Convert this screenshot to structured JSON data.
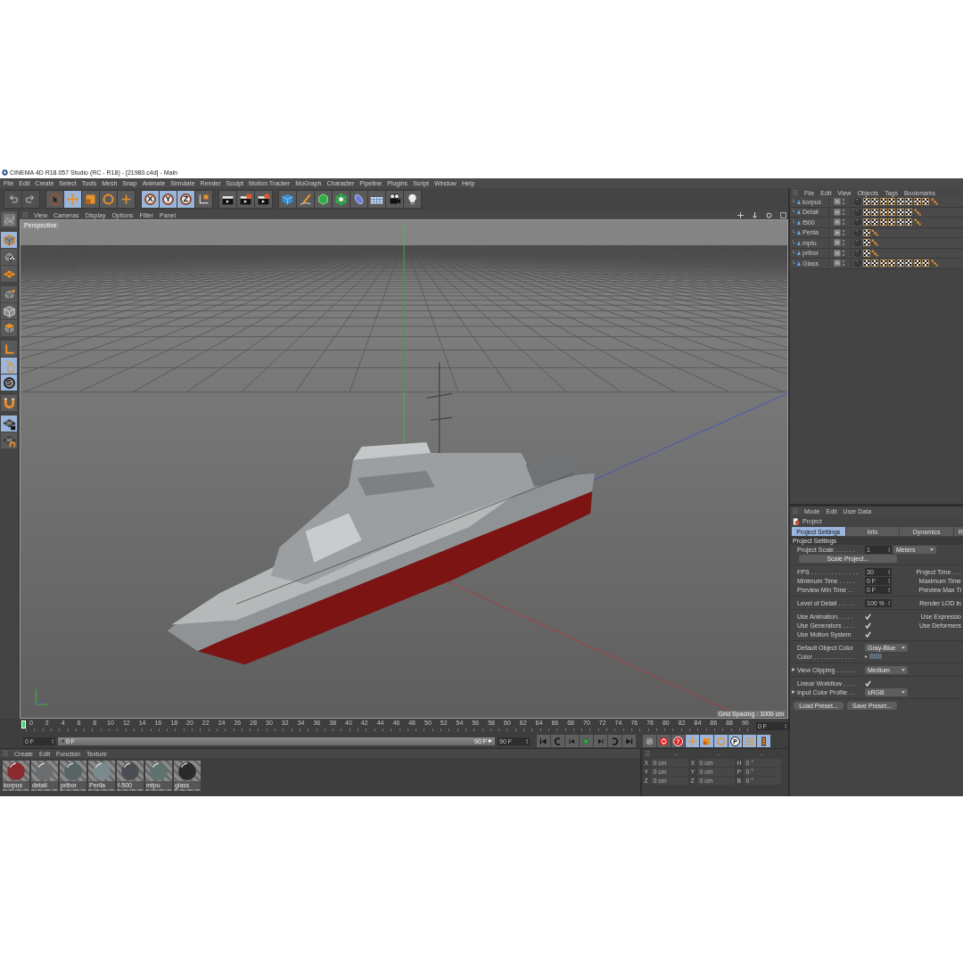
{
  "window": {
    "title": "CINEMA 4D R18.057 Studio (RC - R18) - [21980.c4d] - Main"
  },
  "menu_bar": [
    "File",
    "Edit",
    "Create",
    "Select",
    "Tools",
    "Mesh",
    "Snap",
    "Animate",
    "Simulate",
    "Render",
    "Sculpt",
    "Motion Tracker",
    "MoGraph",
    "Character",
    "Pipeline",
    "Plugins",
    "Script",
    "Window",
    "Help"
  ],
  "toolbar": [
    {
      "items": [
        {
          "kind": "undo",
          "selected": false
        },
        {
          "kind": "redo",
          "selected": false
        }
      ]
    },
    {
      "items": [
        {
          "kind": "select",
          "selected": false
        },
        {
          "kind": "move",
          "selected": true
        },
        {
          "kind": "scale",
          "selected": false
        },
        {
          "kind": "rotate",
          "selected": false
        },
        {
          "kind": "recent",
          "selected": false
        }
      ]
    },
    {
      "items": [
        {
          "kind": "axis",
          "label": "X",
          "selected": true
        },
        {
          "kind": "axis",
          "label": "Y",
          "selected": true
        },
        {
          "kind": "axis",
          "label": "Z",
          "selected": true
        },
        {
          "kind": "coordsys",
          "selected": false
        }
      ]
    },
    {
      "items": [
        {
          "kind": "render-view",
          "selected": false
        },
        {
          "kind": "render-picture",
          "selected": false
        },
        {
          "kind": "render-settings",
          "selected": false
        }
      ]
    },
    {
      "items": [
        {
          "kind": "cube",
          "selected": false
        },
        {
          "kind": "pen",
          "selected": false
        },
        {
          "kind": "subdiv",
          "selected": false
        },
        {
          "kind": "cloner",
          "selected": false
        },
        {
          "kind": "deformer",
          "selected": false
        },
        {
          "kind": "floor",
          "selected": false
        },
        {
          "kind": "camera",
          "selected": false
        },
        {
          "kind": "light",
          "selected": false
        }
      ]
    }
  ],
  "tool_strip": [
    {
      "items": [
        {
          "kind": "editable",
          "selected": false
        }
      ]
    },
    {
      "items": [
        {
          "kind": "model",
          "selected": true
        },
        {
          "kind": "texture",
          "selected": false
        },
        {
          "kind": "workplane",
          "selected": false
        }
      ]
    },
    {
      "items": [
        {
          "kind": "points",
          "selected": false
        },
        {
          "kind": "edges",
          "selected": false
        },
        {
          "kind": "polygons",
          "selected": false
        }
      ]
    },
    {
      "items": [
        {
          "kind": "axis-mode",
          "selected": false
        },
        {
          "kind": "tweak",
          "selected": true
        },
        {
          "kind": "solo",
          "label": "S",
          "selected": true
        }
      ]
    },
    {
      "items": [
        {
          "kind": "snap",
          "selected": false
        }
      ]
    },
    {
      "items": [
        {
          "kind": "wp-lock",
          "selected": true
        },
        {
          "kind": "planar",
          "selected": false
        }
      ]
    }
  ],
  "viewport": {
    "menu": [
      "View",
      "Cameras",
      "Display",
      "Options",
      "Filter",
      "Panel"
    ],
    "camera": "Perspective",
    "grid_spacing": "Grid Spacing : 1000 cm"
  },
  "timeline": {
    "ticks": [
      "0",
      "2",
      "4",
      "6",
      "8",
      "10",
      "12",
      "14",
      "16",
      "18",
      "20",
      "22",
      "24",
      "26",
      "28",
      "30",
      "32",
      "34",
      "36",
      "38",
      "40",
      "42",
      "44",
      "46",
      "48",
      "50",
      "52",
      "54",
      "56",
      "58",
      "60",
      "62",
      "64",
      "66",
      "68",
      "70",
      "72",
      "74",
      "76",
      "78",
      "80",
      "82",
      "84",
      "86",
      "88",
      "90"
    ],
    "current_frame": "0 F",
    "start_field": "0 F",
    "range": {
      "start": "0 F",
      "end": "90 F",
      "level": 1
    },
    "end_field": "90 F",
    "transport": [
      {
        "kind": "first",
        "selected": false
      },
      {
        "kind": "prev-key",
        "selected": false
      },
      {
        "kind": "prev-frame",
        "selected": false
      },
      {
        "kind": "play",
        "selected": false
      },
      {
        "kind": "next-frame",
        "selected": false
      },
      {
        "kind": "next-key",
        "selected": false
      },
      {
        "kind": "last",
        "selected": false
      }
    ],
    "keying": [
      {
        "kind": "key",
        "selected": false
      },
      {
        "kind": "record",
        "selected": false
      },
      {
        "kind": "autokey",
        "label": "?",
        "selected": false
      },
      {
        "kind": "move",
        "selected": true
      },
      {
        "kind": "scale",
        "selected": true
      },
      {
        "kind": "rotate",
        "selected": true
      },
      {
        "kind": "param",
        "label": "P",
        "selected": true
      },
      {
        "kind": "pointgrid",
        "selected": true
      },
      {
        "kind": "timeline",
        "selected": true
      }
    ]
  },
  "materials": {
    "menu": [
      "Create",
      "Edit",
      "Function",
      "Texture"
    ],
    "items": [
      {
        "name": "korpus",
        "color": "#8a2a2a"
      },
      {
        "name": "detali",
        "color": "#6a6e70"
      },
      {
        "name": "pribor",
        "color": "#566466"
      },
      {
        "name": "Perila",
        "color": "#7b8a8c"
      },
      {
        "name": "f-500",
        "color": "#4a4e52"
      },
      {
        "name": "mtpu",
        "color": "#5f7270"
      },
      {
        "name": "glass",
        "color": "#2a2a2a"
      }
    ]
  },
  "coordinates": {
    "headers": [
      "--",
      "--",
      "--"
    ],
    "rows": [
      {
        "axis": "X",
        "position": "0 cm",
        "size_axis": "X",
        "size": "0 cm",
        "rot_axis": "H",
        "rotation": "0 °"
      },
      {
        "axis": "Y",
        "position": "0 cm",
        "size_axis": "Y",
        "size": "0 cm",
        "rot_axis": "P",
        "rotation": "0 °"
      },
      {
        "axis": "Z",
        "position": "0 cm",
        "size_axis": "Z",
        "size": "0 cm",
        "rot_axis": "B",
        "rotation": "0 °"
      }
    ]
  },
  "object_manager": {
    "menu": [
      "File",
      "Edit",
      "View",
      "Objects",
      "Tags",
      "Bookmarks"
    ],
    "objects": [
      {
        "name": "korpus",
        "tags": [
          {
            "kind": "material"
          },
          {
            "kind": "texture"
          },
          {
            "kind": "texture"
          },
          {
            "kind": "texture"
          },
          {
            "kind": "texture"
          },
          {
            "kind": "texture"
          },
          {
            "kind": "texture"
          },
          {
            "kind": "texture"
          },
          {
            "kind": "texture"
          },
          {
            "kind": "selection"
          }
        ]
      },
      {
        "name": "Detali",
        "tags": [
          {
            "kind": "material"
          },
          {
            "kind": "texture"
          },
          {
            "kind": "texture"
          },
          {
            "kind": "texture"
          },
          {
            "kind": "texture"
          },
          {
            "kind": "texture"
          },
          {
            "kind": "texture"
          },
          {
            "kind": "selection"
          }
        ]
      },
      {
        "name": "f500",
        "tags": [
          {
            "kind": "material"
          },
          {
            "kind": "texture"
          },
          {
            "kind": "texture"
          },
          {
            "kind": "texture"
          },
          {
            "kind": "texture"
          },
          {
            "kind": "texture"
          },
          {
            "kind": "texture"
          },
          {
            "kind": "selection"
          }
        ]
      },
      {
        "name": "Perila",
        "tags": [
          {
            "kind": "material"
          },
          {
            "kind": "texture"
          },
          {
            "kind": "selection"
          }
        ]
      },
      {
        "name": "mptu",
        "tags": [
          {
            "kind": "material"
          },
          {
            "kind": "texture"
          },
          {
            "kind": "selection"
          }
        ]
      },
      {
        "name": "pribor",
        "tags": [
          {
            "kind": "material"
          },
          {
            "kind": "texture"
          },
          {
            "kind": "selection"
          }
        ]
      },
      {
        "name": "Glass",
        "tags": [
          {
            "kind": "material"
          },
          {
            "kind": "texture"
          },
          {
            "kind": "texture"
          },
          {
            "kind": "texture"
          },
          {
            "kind": "texture"
          },
          {
            "kind": "texture"
          },
          {
            "kind": "texture"
          },
          {
            "kind": "texture"
          },
          {
            "kind": "texture"
          },
          {
            "kind": "selection"
          }
        ]
      }
    ]
  },
  "attributes": {
    "menu": [
      "Mode",
      "Edit",
      "User Data"
    ],
    "object": "Project",
    "tabs": [
      {
        "label": "Project Settings",
        "selected": true
      },
      {
        "label": "Info",
        "selected": false
      },
      {
        "label": "Dynamics",
        "selected": false
      },
      {
        "label": "R",
        "selected": false
      }
    ],
    "section": "Project Settings",
    "rows": [
      {
        "kind": "scale",
        "label": "Project Scale . . . . . .",
        "value": "1",
        "unit": "Meters"
      },
      {
        "kind": "button",
        "label": "Scale Project..."
      },
      {
        "kind": "separator"
      },
      {
        "kind": "number",
        "label": "FPS . . . . . . . . . . . . . .",
        "value": "30",
        "right_label": "Project Time . . ."
      },
      {
        "kind": "number",
        "label": "Minimum Time . . . . .",
        "value": "0 F",
        "right_label": "Maximum Time"
      },
      {
        "kind": "number",
        "label": "Preview Min Time . .",
        "value": "0 F",
        "right_label": "Preview Max Ti"
      },
      {
        "kind": "separator"
      },
      {
        "kind": "number",
        "label": "Level of Detail . . . . .",
        "value": "100 %",
        "right_label": "Render LOD in"
      },
      {
        "kind": "separator"
      },
      {
        "kind": "check",
        "label": "Use Animation. . . . .",
        "checked": true,
        "right_label": "Use Expressio"
      },
      {
        "kind": "check",
        "label": "Use Generators . . . .",
        "checked": true,
        "right_label": "Use Deformers"
      },
      {
        "kind": "check",
        "label": "Use Motion System",
        "checked": true
      },
      {
        "kind": "separator"
      },
      {
        "kind": "dropdown",
        "label": "Default Object Color",
        "value": "Gray-Blue",
        "expandable": false
      },
      {
        "kind": "color",
        "label": "Color . . . . . . . . . . . .",
        "color": "#5d6a7a"
      },
      {
        "kind": "separator"
      },
      {
        "kind": "dropdown",
        "label": "View Clipping . . . . . .",
        "value": "Medium",
        "expandable": true
      },
      {
        "kind": "separator"
      },
      {
        "kind": "check",
        "label": "Linear Workflow . . . .",
        "checked": true
      },
      {
        "kind": "dropdown",
        "label": "Input Color Profile . .",
        "value": "sRGB",
        "expandable": true
      },
      {
        "kind": "separator"
      },
      {
        "kind": "buttons",
        "labels": [
          "Load Preset...",
          "Save Preset..."
        ]
      }
    ]
  }
}
